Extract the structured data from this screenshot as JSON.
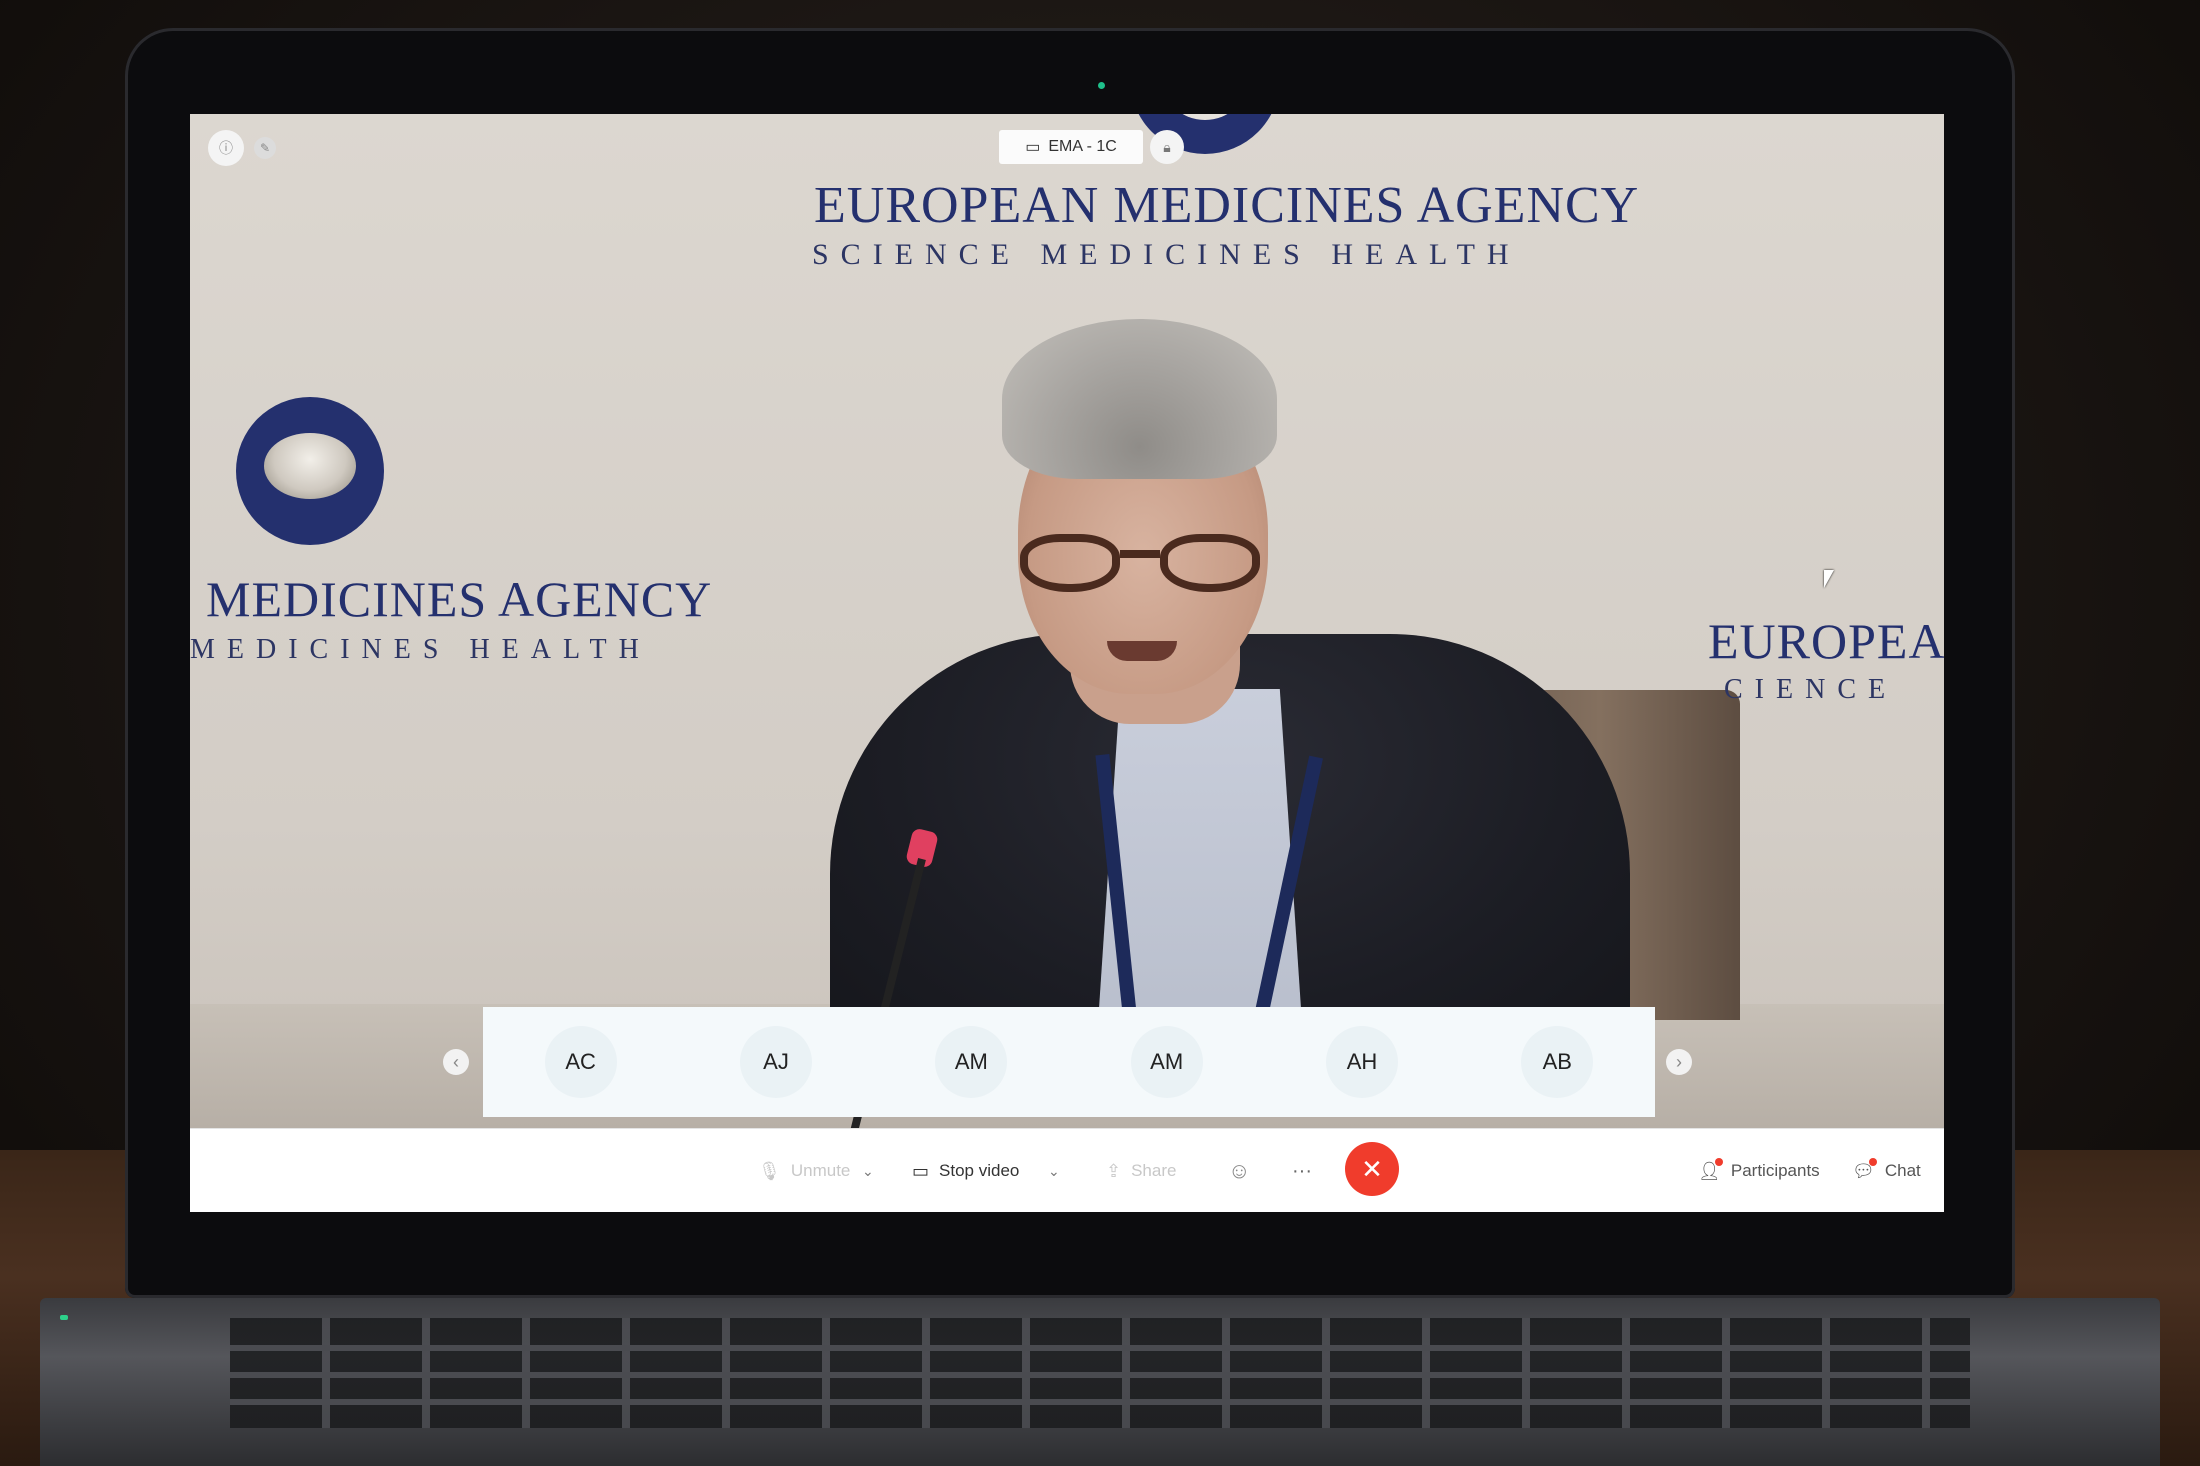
{
  "meeting": {
    "room_name": "EMA - 1C",
    "icons": {
      "info": "info-icon",
      "pin": "pin-icon",
      "lock": "lock-icon",
      "room": "display-icon"
    }
  },
  "backdrop": {
    "agency_center": "EUROPEAN MEDICINES AGENCY",
    "tagline_center": "SCIENCE  MEDICINES  HEALTH",
    "agency_left": "MEDICINES AGENCY",
    "tagline_left": "MEDICINES  HEALTH",
    "agency_right": "EUROPEAN",
    "tagline_right": "CIENCE"
  },
  "participants": {
    "prev_label": "‹",
    "next_label": "›",
    "avatars": [
      "AC",
      "AJ",
      "AM",
      "AM",
      "AH",
      "AB"
    ]
  },
  "controls": {
    "unmute_label": "Unmute",
    "stop_video_label": "Stop video",
    "share_label": "Share",
    "more_label": "···",
    "end_label": "✕",
    "participants_label": "Participants",
    "chat_label": "Chat",
    "accent_end": "#f03c2c"
  }
}
